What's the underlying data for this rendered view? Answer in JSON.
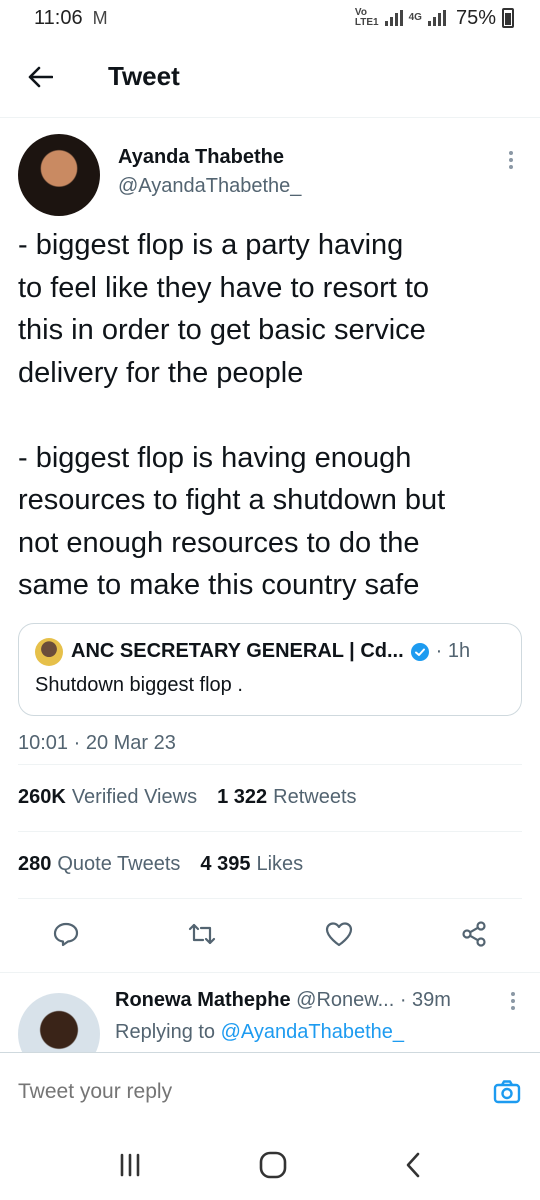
{
  "status_bar": {
    "time": "11:06",
    "carrier_icon": "M",
    "volte_top": "Vo",
    "volte_bottom": "LTE1",
    "network": "4G",
    "battery": "75%"
  },
  "header": {
    "title": "Tweet"
  },
  "tweet": {
    "author_name": "Ayanda Thabethe",
    "author_handle": "@AyandaThabethe_",
    "text": "- biggest flop is a party having\nto feel like they have to resort to\nthis in order to get basic service\ndelivery for the people\n\n- biggest flop is having enough\nresources to fight a shutdown but\nnot enough resources to do the\nsame to make this country safe",
    "quote": {
      "author": "ANC SECRETARY GENERAL | Cd...",
      "time": "· 1h",
      "text": "Shutdown biggest flop ."
    },
    "timestamp": "10:01 · 20 Mar 23",
    "stats": {
      "views_count": "260K",
      "views_label": "Verified Views",
      "retweets_count": "1 322",
      "retweets_label": "Retweets",
      "quotes_count": "280",
      "quotes_label": "Quote Tweets",
      "likes_count": "4 395",
      "likes_label": "Likes"
    }
  },
  "reply": {
    "author_name": "Ronewa Mathephe",
    "author_handle": "@Ronew...",
    "time": "· 39m",
    "replying_prefix": "Replying to",
    "replying_to": "@AyandaThabethe_"
  },
  "compose": {
    "placeholder": "Tweet your reply"
  },
  "colors": {
    "accent": "#1d9bf0",
    "text": "#0f1419",
    "muted": "#536471",
    "border": "#eff3f4"
  }
}
